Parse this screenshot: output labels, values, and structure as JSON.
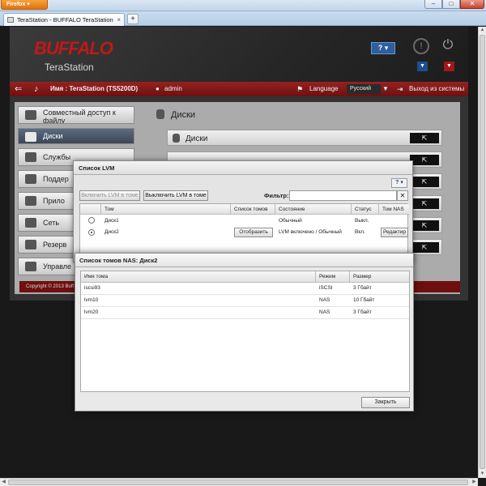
{
  "browser": {
    "menu_button": "Firefox",
    "tab_title": "TeraStation - BUFFALO TeraStation",
    "new_tab": "+",
    "win_min": "–",
    "win_max": "□",
    "win_close": "✕",
    "tab_close": "×"
  },
  "header": {
    "logo": "BUFFALO",
    "logo_sub": "TeraStation",
    "help_button": "? ▾",
    "info_icon": "!",
    "power_icon": "⏻",
    "drop_arrow": "▼"
  },
  "topbar": {
    "machine_name": "Имя : TeraStation (TS5200D)",
    "user": "admin",
    "language_label": "Language",
    "language_value": "Русский",
    "logout": "Выход из системы"
  },
  "sidebar": {
    "items": [
      {
        "label": "Совместный доступ к файлу",
        "icon": "folder-icon"
      },
      {
        "label": "Диски",
        "icon": "disk-icon"
      },
      {
        "label": "Службы",
        "icon": "services-icon"
      },
      {
        "label": "Поддер",
        "icon": "backup-icon"
      },
      {
        "label": "Прило",
        "icon": "apps-icon"
      },
      {
        "label": "Сеть",
        "icon": "network-icon"
      },
      {
        "label": "Резерв",
        "icon": "backup-copy-icon"
      },
      {
        "label": "Управле",
        "icon": "tools-icon"
      }
    ],
    "copyright": "Copyright © 2013 Buff"
  },
  "main": {
    "title": "Диски",
    "first_row_label": "Диски",
    "go_icon": "⇱"
  },
  "lvm_dialog": {
    "title": "Список LVM",
    "help": "? ▾",
    "enable_button": "Включить LVM в томе",
    "disable_button": "Выключить LVM в томе",
    "filter_label": "Фильтр:",
    "filter_value": "",
    "filter_clear": "✕",
    "columns": [
      "",
      "Том",
      "Список томов",
      "Состояние",
      "Статус",
      "Том NAS"
    ],
    "rows": [
      {
        "selected": false,
        "name": "Диск1",
        "list_button": "",
        "state": "Обычный",
        "status": "Выкл.",
        "nas_button": ""
      },
      {
        "selected": true,
        "name": "Диск2",
        "list_button": "Отобразить",
        "state": "LVM включено / Обычный",
        "status": "Вкл.",
        "nas_button": "Редактир"
      }
    ]
  },
  "nas_dialog": {
    "title": "Список томов NAS: Диск2",
    "columns": [
      "Имя тома",
      "Режим",
      "Размер"
    ],
    "rows": [
      {
        "name": "iscsi93",
        "mode": "iSCSI",
        "size": "3 Гбайт"
      },
      {
        "name": "lvm10",
        "mode": "NAS",
        "size": "10 Гбайт"
      },
      {
        "name": "lvm20",
        "mode": "NAS",
        "size": "3 Гбайт"
      }
    ],
    "close_button": "Закрыть"
  }
}
